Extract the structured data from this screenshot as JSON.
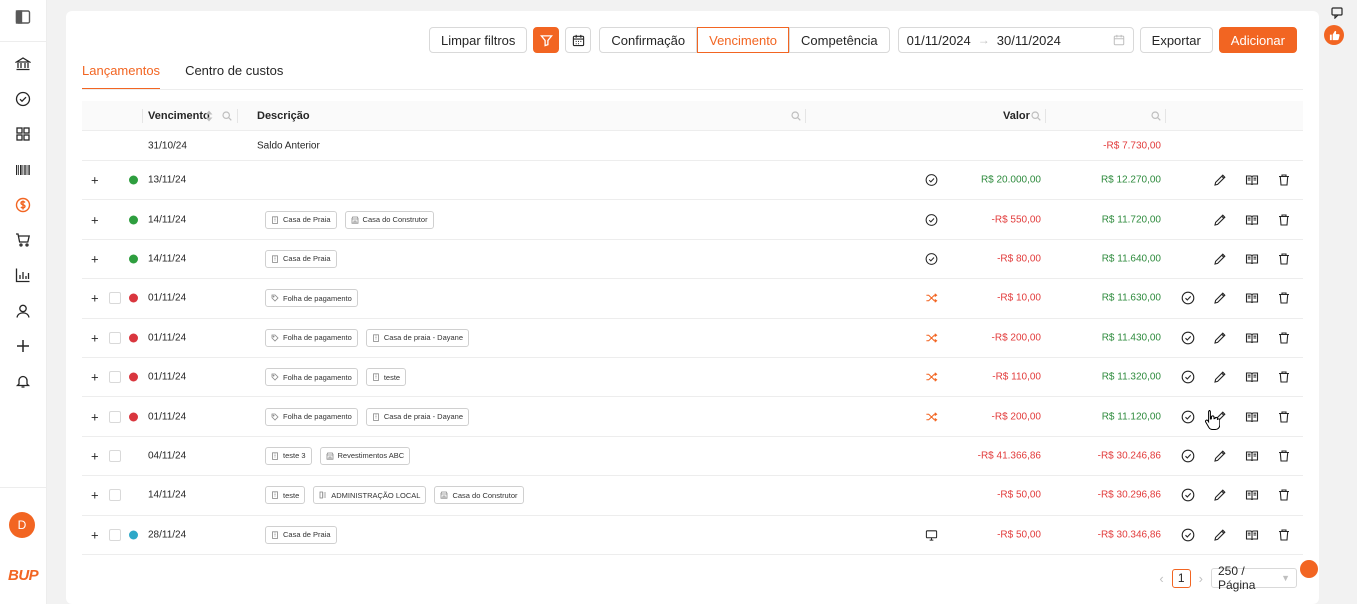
{
  "sidebar": {
    "items": [
      {
        "icon": "sidebar-toggle-icon"
      },
      {
        "icon": "bank-icon"
      },
      {
        "icon": "check-circle-icon"
      },
      {
        "icon": "grid-icon"
      },
      {
        "icon": "barcode-icon"
      },
      {
        "icon": "dollar-circle-icon",
        "active": true
      },
      {
        "icon": "cart-icon"
      },
      {
        "icon": "bar-chart-icon"
      },
      {
        "icon": "user-icon"
      },
      {
        "icon": "plus-icon"
      },
      {
        "icon": "bell-icon"
      }
    ],
    "avatar_letter": "D",
    "brand": "BUP"
  },
  "toolbar": {
    "clear_filters": "Limpar filtros",
    "date_modes": [
      "Confirmação",
      "Vencimento",
      "Competência"
    ],
    "active_mode": "Vencimento",
    "date_start": "01/11/2024",
    "date_end": "30/11/2024",
    "export": "Exportar",
    "add": "Adicionar"
  },
  "tabs": [
    {
      "label": "Lançamentos",
      "active": true
    },
    {
      "label": "Centro de custos",
      "active": false
    }
  ],
  "table": {
    "headers": {
      "due": "Vencimento",
      "description": "Descrição",
      "value": "Valor"
    },
    "saldo": {
      "date": "31/10/24",
      "label": "Saldo Anterior",
      "balance": "-R$ 7.730,00"
    },
    "rows": [
      {
        "date": "13/11/24",
        "dot": "#2e9e3f",
        "checkbox": false,
        "tags": [],
        "status": "check",
        "value": "R$ 20.000,00",
        "value_sign": "pos",
        "balance": "R$ 12.270,00",
        "balance_sign": "pos",
        "confirm": false
      },
      {
        "date": "14/11/24",
        "dot": "#2e9e3f",
        "checkbox": false,
        "tags": [
          {
            "icon": "building-icon",
            "label": "Casa de Praia"
          },
          {
            "icon": "store-icon",
            "label": "Casa do Construtor"
          }
        ],
        "status": "check",
        "value": "-R$ 550,00",
        "value_sign": "neg",
        "balance": "R$ 11.720,00",
        "balance_sign": "pos",
        "confirm": false
      },
      {
        "date": "14/11/24",
        "dot": "#2e9e3f",
        "checkbox": false,
        "tags": [
          {
            "icon": "building-icon",
            "label": "Casa de Praia"
          }
        ],
        "status": "check",
        "value": "-R$ 80,00",
        "value_sign": "neg",
        "balance": "R$ 11.640,00",
        "balance_sign": "pos",
        "confirm": false
      },
      {
        "date": "01/11/24",
        "dot": "#d9363e",
        "checkbox": true,
        "tags": [
          {
            "icon": "tag-icon",
            "label": "Folha de pagamento"
          }
        ],
        "status": "shuffle",
        "value": "-R$ 10,00",
        "value_sign": "neg",
        "balance": "R$ 11.630,00",
        "balance_sign": "pos",
        "confirm": true
      },
      {
        "date": "01/11/24",
        "dot": "#d9363e",
        "checkbox": true,
        "tags": [
          {
            "icon": "tag-icon",
            "label": "Folha de pagamento"
          },
          {
            "icon": "building-icon",
            "label": "Casa de praia - Dayane"
          }
        ],
        "status": "shuffle",
        "value": "-R$ 200,00",
        "value_sign": "neg",
        "balance": "R$ 11.430,00",
        "balance_sign": "pos",
        "confirm": true
      },
      {
        "date": "01/11/24",
        "dot": "#d9363e",
        "checkbox": true,
        "tags": [
          {
            "icon": "tag-icon",
            "label": "Folha de pagamento"
          },
          {
            "icon": "building-icon",
            "label": "teste"
          }
        ],
        "status": "shuffle",
        "value": "-R$ 110,00",
        "value_sign": "neg",
        "balance": "R$ 11.320,00",
        "balance_sign": "pos",
        "confirm": true
      },
      {
        "date": "01/11/24",
        "dot": "#d9363e",
        "checkbox": true,
        "tags": [
          {
            "icon": "tag-icon",
            "label": "Folha de pagamento"
          },
          {
            "icon": "building-icon",
            "label": "Casa de praia - Dayane"
          }
        ],
        "status": "shuffle",
        "value": "-R$ 200,00",
        "value_sign": "neg",
        "balance": "R$ 11.120,00",
        "balance_sign": "pos",
        "confirm": true
      },
      {
        "date": "04/11/24",
        "dot": "",
        "checkbox": true,
        "tags": [
          {
            "icon": "building-icon",
            "label": "teste 3"
          },
          {
            "icon": "store-icon",
            "label": "Revestimentos ABC"
          }
        ],
        "status": "",
        "value": "-R$ 41.366,86",
        "value_sign": "neg",
        "balance": "-R$ 30.246,86",
        "balance_sign": "neg",
        "confirm": true
      },
      {
        "date": "14/11/24",
        "dot": "",
        "checkbox": true,
        "tags": [
          {
            "icon": "building-icon",
            "label": "teste"
          },
          {
            "icon": "org-icon",
            "label": "ADMINISTRAÇÃO LOCAL"
          },
          {
            "icon": "store-icon",
            "label": "Casa do Construtor"
          }
        ],
        "status": "",
        "value": "-R$ 50,00",
        "value_sign": "neg",
        "balance": "-R$ 30.296,86",
        "balance_sign": "neg",
        "confirm": true
      },
      {
        "date": "28/11/24",
        "dot": "#2ea8c8",
        "checkbox": true,
        "tags": [
          {
            "icon": "building-icon",
            "label": "Casa de Praia"
          }
        ],
        "status": "monitor",
        "value": "-R$ 50,00",
        "value_sign": "neg",
        "balance": "-R$ 30.346,86",
        "balance_sign": "neg",
        "confirm": true
      }
    ]
  },
  "pager": {
    "page": "1",
    "page_size": "250 / Página"
  },
  "colors": {
    "accent": "#f26522",
    "negative": "#e23b3b",
    "positive": "#2e8b3d"
  }
}
